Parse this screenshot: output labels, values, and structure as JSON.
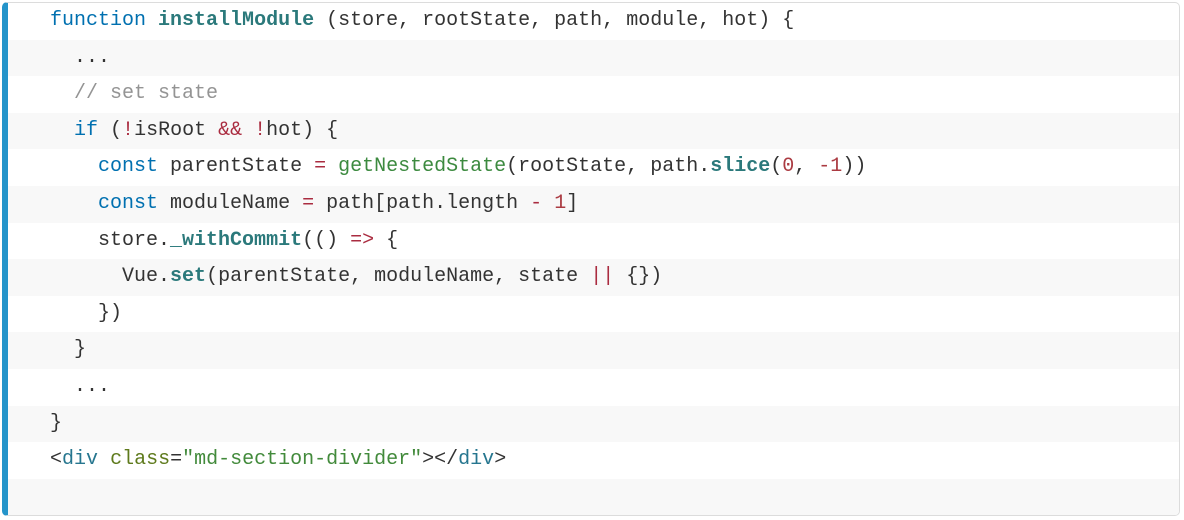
{
  "code": {
    "l1": {
      "kw_function": "function",
      "fn_name": "installModule",
      "params_open": " (",
      "p1": "store",
      "c1": ", ",
      "p2": "rootState",
      "c2": ", ",
      "p3": "path",
      "c3": ", ",
      "p4": "module",
      "c4": ", ",
      "p5": "hot",
      "params_close": ") ",
      "brace_open": "{"
    },
    "l2": {
      "ellipsis": "..."
    },
    "l3": {
      "comment": "// set state"
    },
    "l4": {
      "kw_if": "if",
      "sp1": " (",
      "not1": "!",
      "id1": "isRoot ",
      "and": "&&",
      "sp2": " ",
      "not2": "!",
      "id2": "hot) ",
      "brace": "{"
    },
    "l5": {
      "kw_const": "const",
      "sp1": " ",
      "var1": "parentState ",
      "eq": "=",
      "sp2": " ",
      "fn": "getNestedState",
      "open": "(",
      "arg1": "rootState",
      "c1": ", ",
      "arg2": "path",
      "dot": ".",
      "slice": "slice",
      "open2": "(",
      "zero": "0",
      "c2": ", ",
      "neg": "-1",
      "close": "))"
    },
    "l6": {
      "kw_const": "const",
      "sp1": " ",
      "var1": "moduleName ",
      "eq": "=",
      "sp2": " ",
      "expr1": "path[path",
      "dot": ".",
      "len": "length ",
      "minus": "-",
      "sp3": " ",
      "one": "1",
      "close": "]"
    },
    "l7": {
      "obj": "store",
      "dot": ".",
      "fn": "_withCommit",
      "open": "(",
      "paren_empty": "()",
      "sp1": " ",
      "arrow": "=>",
      "sp2": " ",
      "brace": "{"
    },
    "l8": {
      "obj": "Vue",
      "dot": ".",
      "fn": "set",
      "open": "(",
      "a1": "parentState",
      "c1": ", ",
      "a2": "moduleName",
      "c2": ", ",
      "a3": "state ",
      "or": "||",
      "sp1": " ",
      "empty": "{})"
    },
    "l9": {
      "close": "})"
    },
    "l10": {
      "brace": "}"
    },
    "l11": {
      "ellipsis": "..."
    },
    "l12": {
      "brace": "}"
    },
    "l13": {
      "open": "<",
      "tag1": "div",
      "sp1": " ",
      "attr": "class",
      "eq": "=",
      "str": "\"md-section-divider\"",
      "close1": ">",
      "open2": "</",
      "tag2": "div",
      "close2": ">"
    }
  }
}
